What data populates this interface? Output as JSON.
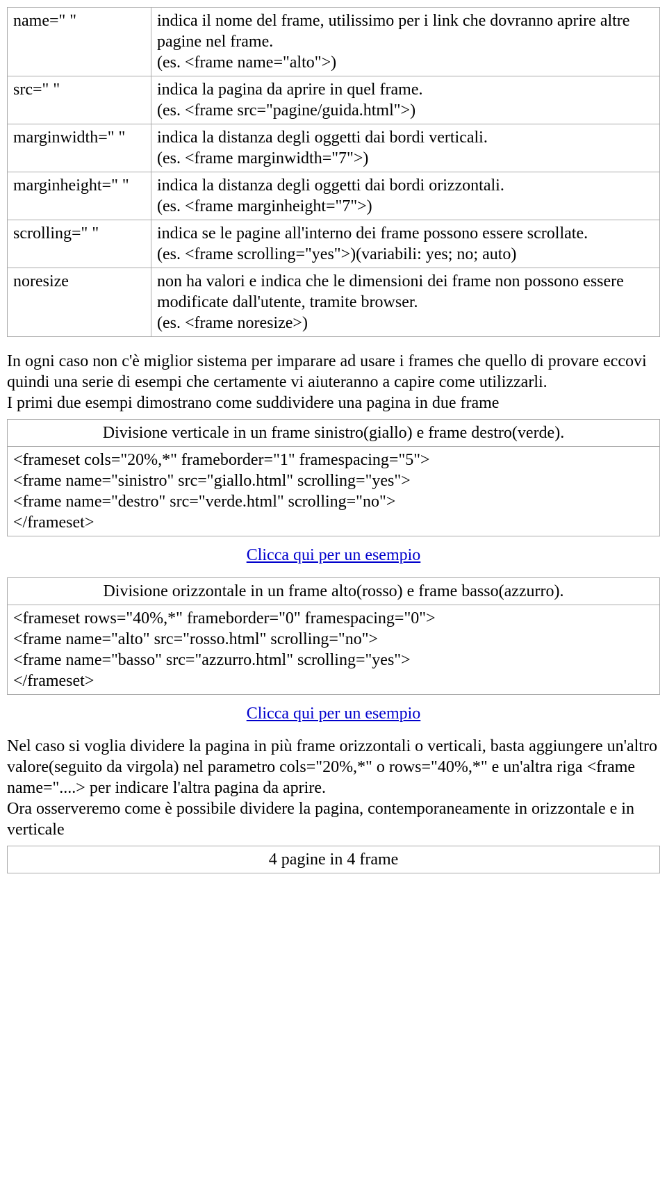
{
  "attr_table": {
    "rows": [
      {
        "left": "name=\" \"",
        "right": "indica il nome del frame, utilissimo per i link che dovranno aprire altre pagine nel frame.\n(es. <frame name=\"alto\">)"
      },
      {
        "left": "src=\" \"",
        "right": "indica la pagina da aprire in quel frame.\n(es. <frame src=\"pagine/guida.html\">)"
      },
      {
        "left": "marginwidth=\" \"",
        "right": "indica la distanza degli oggetti dai bordi verticali.\n(es. <frame marginwidth=\"7\">)"
      },
      {
        "left": "marginheight=\" \"",
        "right": "indica la distanza degli oggetti dai bordi orizzontali.\n(es. <frame marginheight=\"7\">)"
      },
      {
        "left": "scrolling=\" \"",
        "right": "indica se le pagine all'interno dei frame possono essere scrollate.\n(es. <frame scrolling=\"yes\">)(variabili: yes; no; auto)"
      },
      {
        "left": "noresize",
        "right": "non ha valori e indica che le dimensioni dei frame non possono essere modificate dall'utente, tramite browser.\n(es. <frame noresize>)"
      }
    ]
  },
  "paragraph1": "In ogni caso non c'è miglior sistema per imparare ad usare i frames che quello di provare eccovi quindi una serie di esempi che certamente vi aiuteranno a capire come utilizzarli.\nI primi due esempi dimostrano come suddividere una pagina in due frame",
  "example1": {
    "header": "Divisione verticale in un frame sinistro(giallo) e frame destro(verde).",
    "code": "<frameset cols=\"20%,*\" frameborder=\"1\" framespacing=\"5\">\n<frame name=\"sinistro\" src=\"giallo.html\" scrolling=\"yes\">\n<frame name=\"destro\" src=\"verde.html\" scrolling=\"no\">\n</frameset>"
  },
  "link1": "Clicca qui per un esempio",
  "example2": {
    "header": "Divisione orizzontale in un frame alto(rosso) e frame basso(azzurro).",
    "code": "<frameset rows=\"40%,*\" frameborder=\"0\" framespacing=\"0\">\n<frame name=\"alto\" src=\"rosso.html\" scrolling=\"no\">\n<frame name=\"basso\" src=\"azzurro.html\" scrolling=\"yes\">\n</frameset>"
  },
  "link2": "Clicca qui per un esempio",
  "paragraph2": "Nel caso si voglia dividere la pagina in più frame orizzontali o verticali, basta aggiungere un'altro valore(seguito da virgola) nel parametro cols=\"20%,*\" o rows=\"40%,*\" e un'altra riga <frame name=\"....> per indicare l'altra pagina da aprire.\nOra osserveremo come è possibile dividere la pagina, contemporaneamente in orizzontale e in verticale",
  "example3": {
    "header": "4 pagine in 4 frame"
  }
}
